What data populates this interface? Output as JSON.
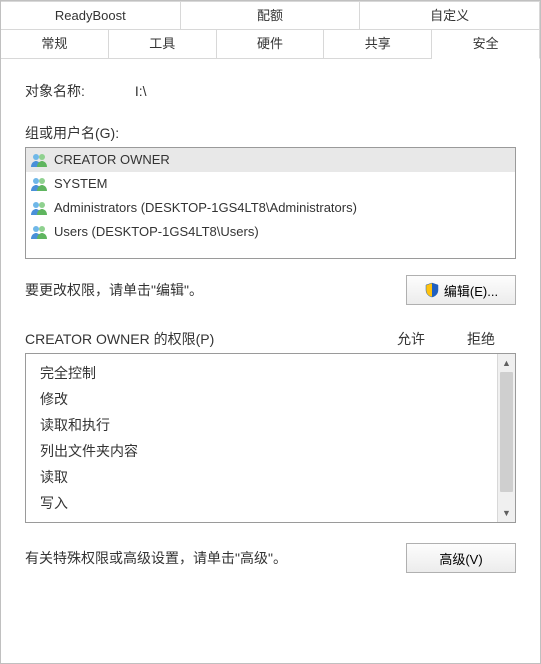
{
  "tabs_row1": [
    {
      "label": "ReadyBoost"
    },
    {
      "label": "配额"
    },
    {
      "label": "自定义"
    }
  ],
  "tabs_row2": [
    {
      "label": "常规"
    },
    {
      "label": "工具"
    },
    {
      "label": "硬件"
    },
    {
      "label": "共享"
    },
    {
      "label": "安全",
      "active": true
    }
  ],
  "object_name_label": "对象名称:",
  "object_name_value": "I:\\",
  "groups_label": "组或用户名(G):",
  "groups_list": [
    {
      "name": "CREATOR OWNER",
      "selected": true
    },
    {
      "name": "SYSTEM"
    },
    {
      "name": "Administrators (DESKTOP-1GS4LT8\\Administrators)"
    },
    {
      "name": "Users (DESKTOP-1GS4LT8\\Users)"
    }
  ],
  "edit_hint": "要更改权限，请单击\"编辑\"。",
  "edit_button": "编辑(E)...",
  "perm_title": "CREATOR OWNER 的权限(P)",
  "perm_allow": "允许",
  "perm_deny": "拒绝",
  "permissions": [
    "完全控制",
    "修改",
    "读取和执行",
    "列出文件夹内容",
    "读取",
    "写入"
  ],
  "advanced_hint": "有关特殊权限或高级设置，请单击\"高级\"。",
  "advanced_button": "高级(V)"
}
